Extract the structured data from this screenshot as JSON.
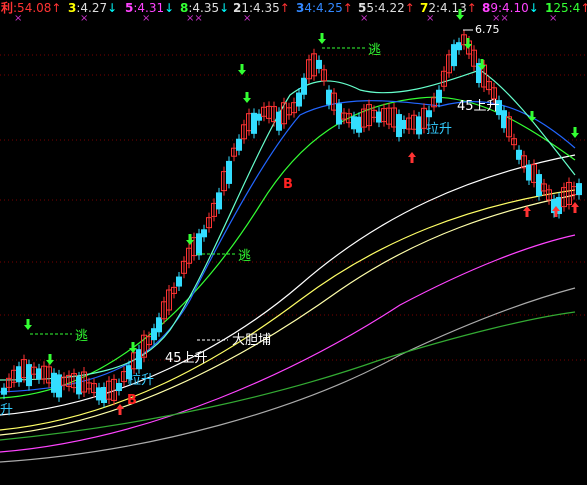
{
  "header": {
    "items": [
      {
        "num": "利",
        "val": ":54.08",
        "arrow": "↑",
        "numColor": "#ff3333",
        "valColor": "#ff3333",
        "arrowColor": "#ff3333",
        "marks": "×"
      },
      {
        "num": "3",
        "val": ":4.27",
        "arrow": "↓",
        "numColor": "#ffff00",
        "valColor": "#dddddd",
        "arrowColor": "#00ffff",
        "marks": "×"
      },
      {
        "num": "5",
        "val": ":4.31",
        "arrow": "↓",
        "numColor": "#ff44ff",
        "valColor": "#ff44ff",
        "arrowColor": "#00ffff",
        "marks": "×"
      },
      {
        "num": "8",
        "val": ":4.35",
        "arrow": "↓",
        "numColor": "#33ff33",
        "valColor": "#dddddd",
        "arrowColor": "#00ffff",
        "marks": "××"
      },
      {
        "num": "2",
        "val": "1:4.35",
        "arrow": "↑",
        "numColor": "#dddddd",
        "valColor": "#dddddd",
        "arrowColor": "#ff3333",
        "marks": "×"
      },
      {
        "num": "3",
        "val": "4:4.25",
        "arrow": "↑",
        "numColor": "#3388ff",
        "valColor": "#3388ff",
        "arrowColor": "#ff3333",
        "marks": ""
      },
      {
        "num": "5",
        "val": "5:4.22",
        "arrow": "↑",
        "numColor": "#dddddd",
        "valColor": "#dddddd",
        "arrowColor": "#ff3333",
        "marks": "×"
      },
      {
        "num": "7",
        "val": "2:4.13",
        "arrow": "↑",
        "numColor": "#ffff00",
        "valColor": "#dddddd",
        "arrowColor": "#ff3333",
        "marks": "×"
      },
      {
        "num": "8",
        "val": "9:4.10",
        "arrow": "↓",
        "numColor": "#ff44ff",
        "valColor": "#ff44ff",
        "arrowColor": "#00ffff",
        "marks": "××"
      },
      {
        "num": "1",
        "val": "25:4",
        "arrow": "↑",
        "numColor": "#33ff33",
        "valColor": "#33ff33",
        "arrowColor": "#ff3333",
        "marks": "×"
      }
    ]
  },
  "chart_data": {
    "type": "line",
    "x": [
      0,
      5,
      10,
      15,
      20,
      25,
      30,
      35,
      40,
      45,
      50,
      55,
      60,
      65,
      70,
      75,
      80,
      85,
      90,
      95,
      100,
      105,
      110,
      115,
      120,
      125,
      130,
      135,
      140,
      145,
      150,
      155,
      160,
      165,
      170,
      175,
      180,
      185,
      190,
      195,
      200,
      205,
      210,
      215,
      220,
      225,
      230,
      235,
      240,
      245,
      250,
      255,
      260,
      265,
      270,
      275,
      280,
      285,
      290,
      295,
      300,
      305,
      310,
      315,
      320,
      325,
      330,
      335,
      340,
      345,
      350,
      355,
      360,
      365,
      370,
      375,
      380,
      385,
      390,
      395,
      400,
      405,
      410,
      415,
      420,
      425,
      430,
      435,
      440,
      445,
      450,
      455,
      460,
      465,
      470,
      475,
      480,
      485,
      490,
      495,
      500,
      505,
      510,
      515,
      520,
      525,
      530,
      535,
      540,
      545,
      550,
      555,
      560,
      565,
      570,
      575
    ],
    "price_peak_label": "6.75",
    "grid": true,
    "annotations": [
      {
        "text": "逃",
        "color": "#33ff33"
      },
      {
        "text": "逃",
        "color": "#33ff33"
      },
      {
        "text": "逃",
        "color": "#33ff33"
      },
      {
        "text": "大胆埔",
        "color": "#ffffff"
      },
      {
        "text": "45上升",
        "color": "#ffffff"
      },
      {
        "text": "45上升",
        "color": "#ffffff"
      },
      {
        "text": "拉升",
        "color": "#33ccff"
      },
      {
        "text": "拉升",
        "color": "#33ccff"
      },
      {
        "text": "升",
        "color": "#33ccff"
      },
      {
        "text": "B",
        "color": "#ff2222"
      },
      {
        "text": "B",
        "color": "#ff2222"
      }
    ]
  }
}
